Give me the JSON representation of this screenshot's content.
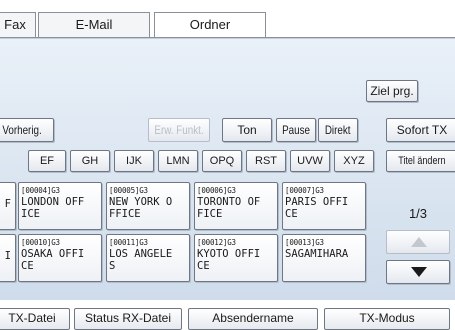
{
  "tabs": [
    {
      "id": "fax",
      "label": "Fax"
    },
    {
      "id": "email",
      "label": "E-Mail"
    },
    {
      "id": "folder",
      "label": "Ordner"
    }
  ],
  "toolbar": {
    "ziel_prg": "Ziel prg.",
    "vorherig": "Vorherig.",
    "erw_funkt": "Erw. Funkt.",
    "ton": "Ton",
    "pause": "Pause",
    "direkt": "Direkt",
    "sofort_tx": "Sofort TX"
  },
  "alphabet": [
    "EF",
    "GH",
    "IJK",
    "LMN",
    "OPQ",
    "RST",
    "UVW",
    "XYZ"
  ],
  "titel_aendern": "Titel ändern",
  "left_partials": [
    "F",
    "I"
  ],
  "destinations": [
    {
      "code": "[00004]G3",
      "line1": "LONDON OFF",
      "line2": "ICE"
    },
    {
      "code": "[00005]G3",
      "line1": "NEW YORK O",
      "line2": "FFICE"
    },
    {
      "code": "[00006]G3",
      "line1": "TORONTO OF",
      "line2": "FICE"
    },
    {
      "code": "[00007]G3",
      "line1": "PARIS OFFI",
      "line2": "CE"
    },
    {
      "code": "[00010]G3",
      "line1": "OSAKA OFFI",
      "line2": "CE"
    },
    {
      "code": "[00011]G3",
      "line1": "LOS ANGELE",
      "line2": "S"
    },
    {
      "code": "[00012]G3",
      "line1": "KYOTO OFFI",
      "line2": "CE"
    },
    {
      "code": "[00013]G3",
      "line1": "SAGAMIHARA",
      "line2": ""
    }
  ],
  "pager": {
    "page": "1/3",
    "up_icon": "triangle-up-icon",
    "down_icon": "triangle-down-icon"
  },
  "bottom": [
    {
      "label": "TX-Datei"
    },
    {
      "label": "Status RX-Datei"
    },
    {
      "label": "Absendername"
    },
    {
      "label": "TX-Modus"
    }
  ]
}
